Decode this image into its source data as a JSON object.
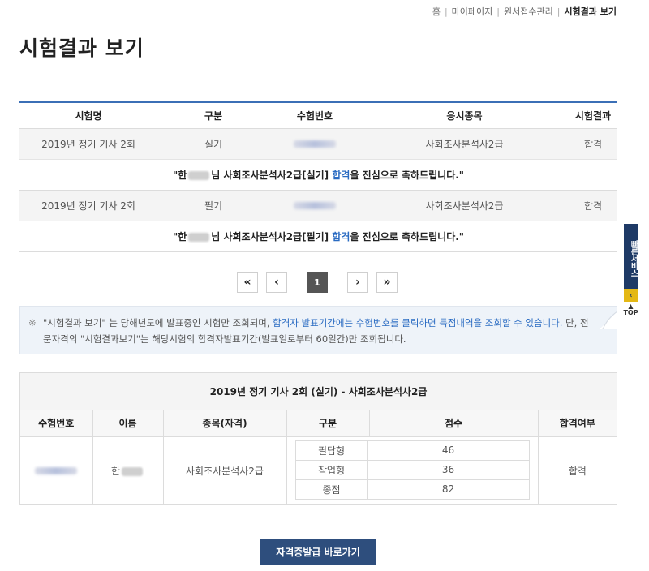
{
  "breadcrumb": {
    "items": [
      "홈",
      "마이페이지",
      "원서접수관리"
    ],
    "current": "시험결과 보기"
  },
  "page_title": "시험결과 보기",
  "results_table": {
    "headers": [
      "시험명",
      "구분",
      "수험번호",
      "응시종목",
      "시험결과"
    ],
    "rows": [
      {
        "exam": "2019년 정기 기사 2회",
        "type": "실기",
        "subject": "사회조사분석사2급",
        "result": "합격",
        "msg_start": "\"한",
        "msg_mid": "님 사회조사분석사2급[실기] ",
        "msg_pass": "합격",
        "msg_end": "을 진심으로 축하드립니다.\""
      },
      {
        "exam": "2019년 정기 기사 2회",
        "type": "필기",
        "subject": "사회조사분석사2급",
        "result": "합격",
        "msg_start": "\"한",
        "msg_mid": "님 사회조사분석사2급[필기] ",
        "msg_pass": "합격",
        "msg_end": "을 진심으로 축하드립니다.\""
      }
    ]
  },
  "pagination": {
    "first": "«",
    "prev": "‹",
    "current": "1",
    "next": "›",
    "last": "»"
  },
  "notice": {
    "mark": "※",
    "part1": "\"시험결과 보기\" 는 당해년도에 발표중인 시험만 조회되며, ",
    "highlight": "합격자 발표기간에는 수험번호를 클릭하면 득점내역을 조회할 수 있습니다.",
    "part2": " 단, 전문자격의 \"시험결과보기\"는 해당시험의 합격자발표기간(발표일로부터 60일간)만 조회됩니다."
  },
  "detail": {
    "title": "2019년 정기 기사 2회 (실기) - 사회조사분석사2급",
    "headers": [
      "수험번호",
      "이름",
      "종목(자격)",
      "구분",
      "점수",
      "합격여부"
    ],
    "name_prefix": "한",
    "subject": "사회조사분석사2급",
    "scores": [
      {
        "label": "필답형",
        "value": "46"
      },
      {
        "label": "작업형",
        "value": "36"
      },
      {
        "label": "종점",
        "value": "82"
      }
    ],
    "pass_status": "합격"
  },
  "cert_button": "자격증발급 바로가기",
  "quick_service": {
    "label": "빠른서비스",
    "arrow": "‹",
    "top_label": "TOP"
  },
  "colors": {
    "accent_blue": "#3b6fb6",
    "link_blue": "#2a6bc2",
    "button_navy": "#2e4e7d",
    "quick_yellow": "#e4b815"
  }
}
